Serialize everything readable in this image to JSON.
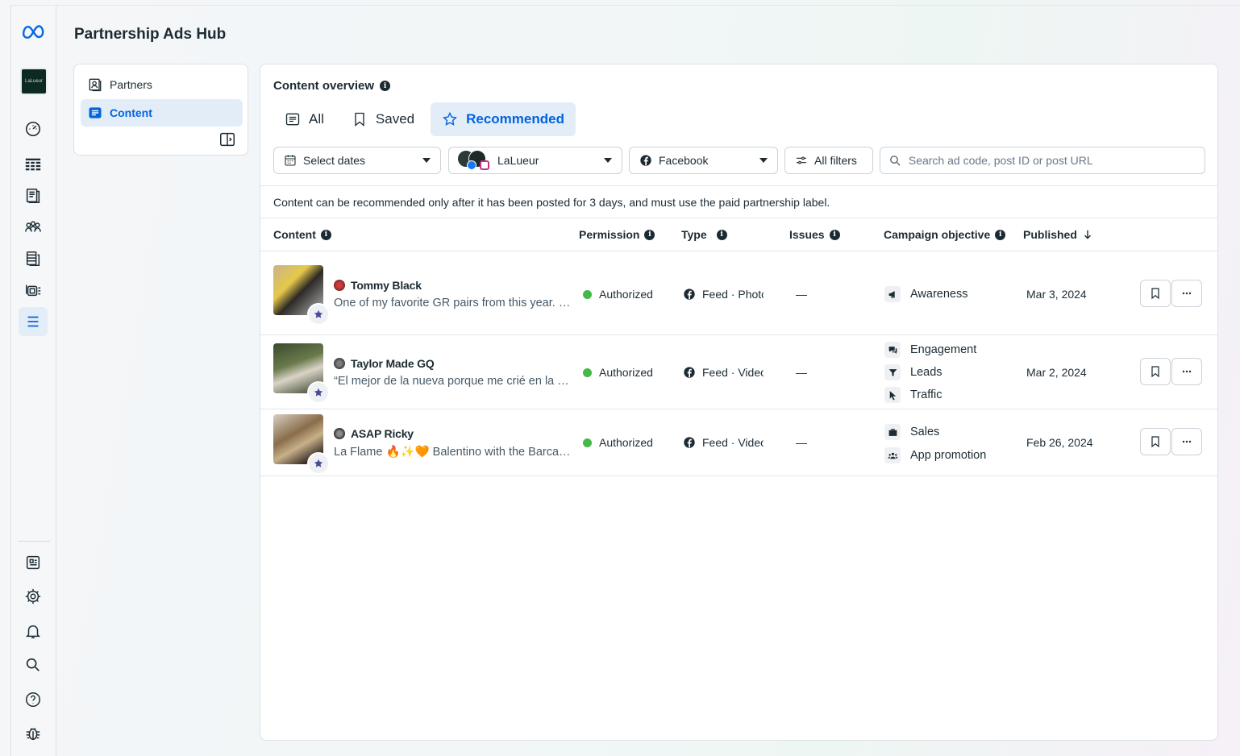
{
  "app": {
    "title": "Partnership Ads Hub",
    "account_thumb_text": "LaLueur"
  },
  "rail": {
    "items": [
      {
        "icon": "dashboard-icon"
      },
      {
        "icon": "table-grid-icon"
      },
      {
        "icon": "pages-icon"
      },
      {
        "icon": "audience-icon"
      },
      {
        "icon": "database-icon"
      },
      {
        "icon": "catalog-icon"
      },
      {
        "icon": "menu-list-icon"
      }
    ],
    "bottom_items": [
      {
        "icon": "news-icon"
      },
      {
        "icon": "gear-icon"
      },
      {
        "icon": "bell-icon"
      },
      {
        "icon": "search-icon"
      },
      {
        "icon": "help-icon"
      },
      {
        "icon": "bug-icon"
      }
    ]
  },
  "nav": {
    "items": [
      {
        "label": "Partners",
        "icon": "partners-icon",
        "active": false
      },
      {
        "label": "Content",
        "icon": "content-icon",
        "active": true
      }
    ]
  },
  "main": {
    "title": "Content overview",
    "tabs": [
      {
        "label": "All",
        "icon": "list-icon",
        "active": false
      },
      {
        "label": "Saved",
        "icon": "bookmark-icon",
        "active": false
      },
      {
        "label": "Recommended",
        "icon": "star-icon",
        "active": true
      }
    ],
    "filters": {
      "dates": "Select dates",
      "account": "LaLueur",
      "platform": "Facebook",
      "all_filters": "All filters",
      "search_placeholder": "Search ad code, post ID or post URL"
    },
    "hint": "Content can be recommended only after it has been posted for 3 days, and must use the paid partnership label.",
    "columns": {
      "content": "Content",
      "permission": "Permission",
      "type": "Type",
      "issues": "Issues",
      "objective": "Campaign objective",
      "published": "Published"
    },
    "rows": [
      {
        "creator": "Tommy Black",
        "caption": "One of my favorite GR pairs from this year. Such a clean colorway.",
        "permission": "Authorized",
        "type": "Feed · Photo",
        "issues": "—",
        "objectives": [
          {
            "label": "Awareness",
            "icon": "megaphone-icon"
          }
        ],
        "published": "Mar 3, 2024"
      },
      {
        "creator": "Taylor Made GQ",
        "caption": "“El mejor de la nueva porque me crié en la ciudad",
        "permission": "Authorized",
        "type": "Feed · Video",
        "issues": "—",
        "objectives": [
          {
            "label": "Engagement",
            "icon": "chat-icon"
          },
          {
            "label": "Leads",
            "icon": "funnel-icon"
          },
          {
            "label": "Traffic",
            "icon": "cursor-icon"
          }
        ],
        "published": "Mar 2, 2024"
      },
      {
        "creator": "ASAP Ricky",
        "caption": "La Flame 🔥✨🧡 Balentino with the Barcalona fits",
        "permission": "Authorized",
        "type": "Feed · Video",
        "issues": "—",
        "objectives": [
          {
            "label": "Sales",
            "icon": "briefcase-icon"
          },
          {
            "label": "App promotion",
            "icon": "people-icon"
          }
        ],
        "published": "Feb 26, 2024"
      }
    ]
  },
  "colors": {
    "accent": "#0064e0",
    "accent_bg": "#e3edf8",
    "status_ok": "#44b849"
  }
}
